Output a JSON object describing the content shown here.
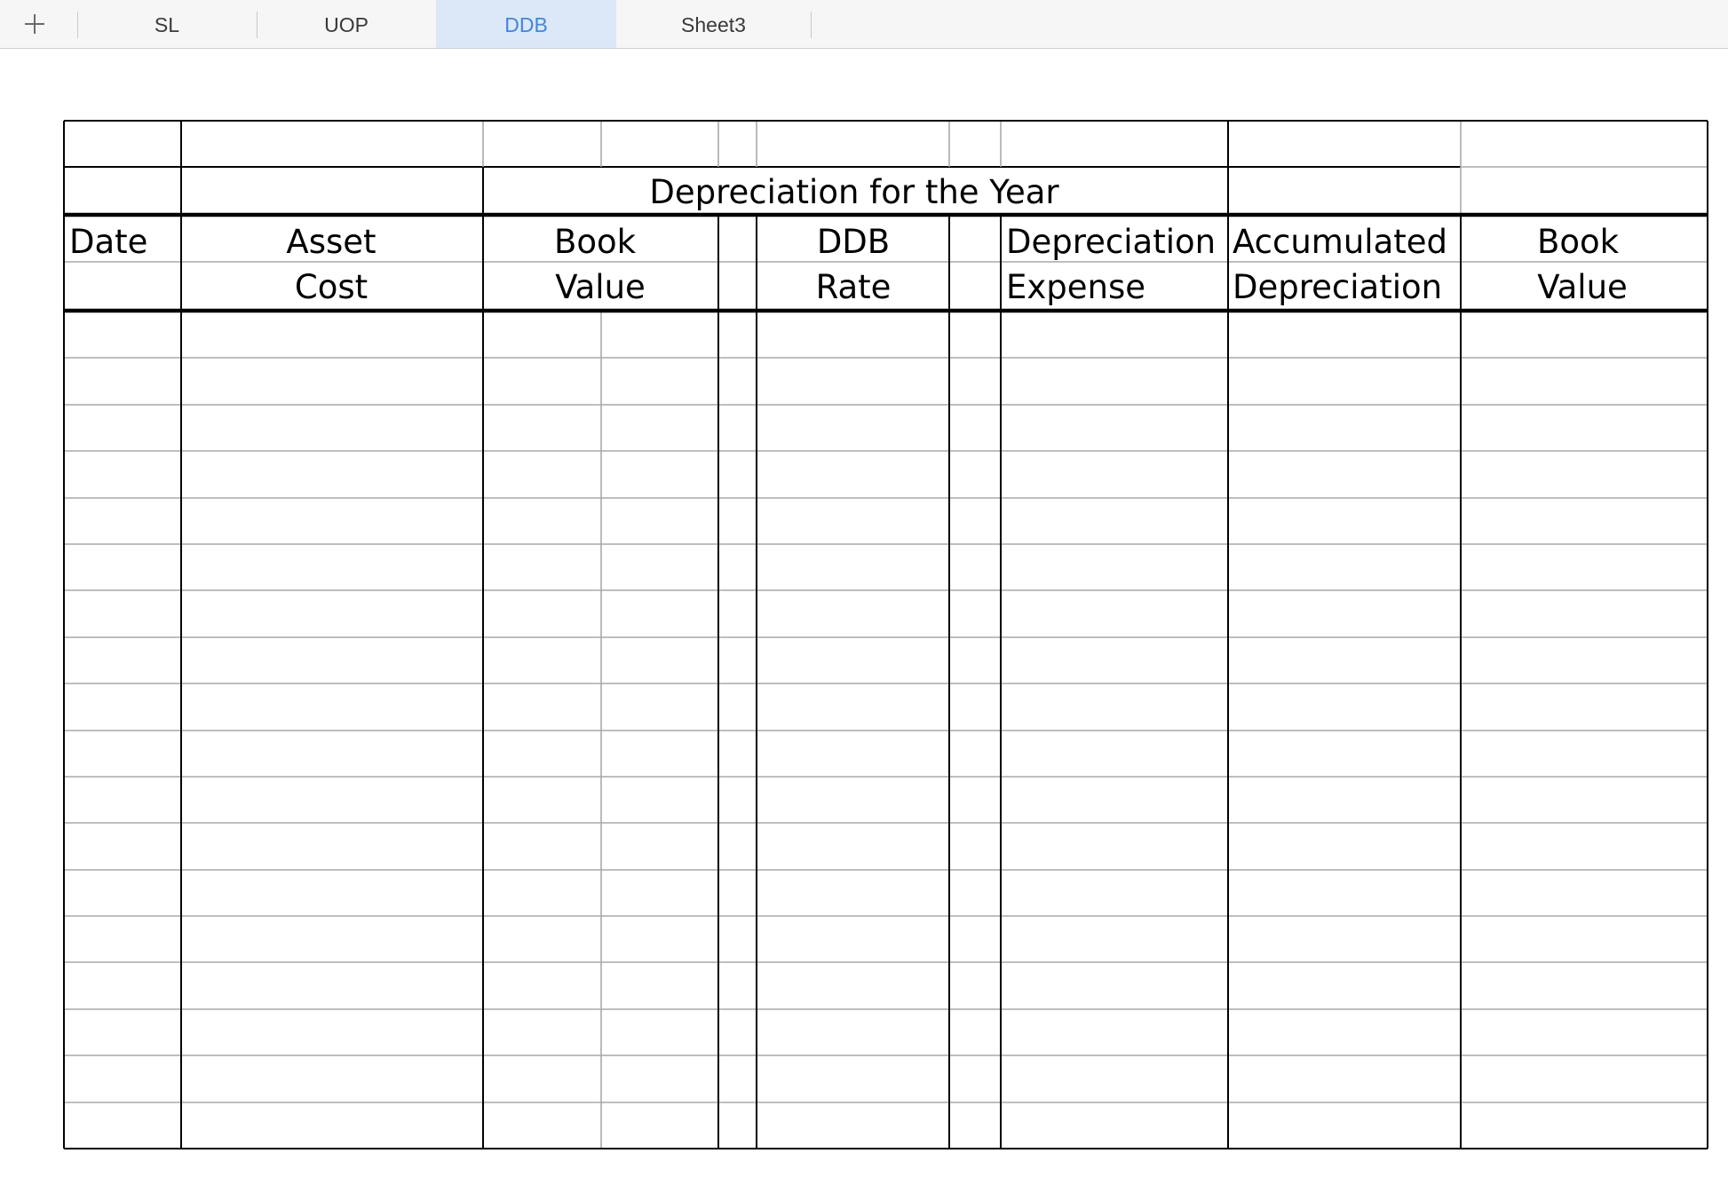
{
  "tabs": {
    "add_icon": "plus-icon",
    "items": [
      {
        "label": "SL",
        "active": false
      },
      {
        "label": "UOP",
        "active": false
      },
      {
        "label": "DDB",
        "active": true
      },
      {
        "label": "Sheet3",
        "active": false
      }
    ]
  },
  "sheet": {
    "title": "Depreciation for the Year",
    "headers": {
      "date": [
        "Date",
        ""
      ],
      "asset_cost": [
        "Asset",
        "Cost"
      ],
      "book_value_start": [
        "Book",
        "Value"
      ],
      "ddb_rate": [
        "DDB",
        "Rate"
      ],
      "depreciation_expense": [
        "Depreciation",
        "Expense"
      ],
      "accumulated_depreciation": [
        "Accumulated",
        "Depreciation"
      ],
      "book_value_end": [
        "Book",
        "Value"
      ]
    },
    "empty_body_rows": 18
  },
  "colors": {
    "tab_active_bg": "#dce8f8",
    "tab_active_text": "#3f86e0",
    "tabbar_bg": "#f6f6f6",
    "border_strong": "#000000",
    "border_light": "#a9a9a9"
  }
}
